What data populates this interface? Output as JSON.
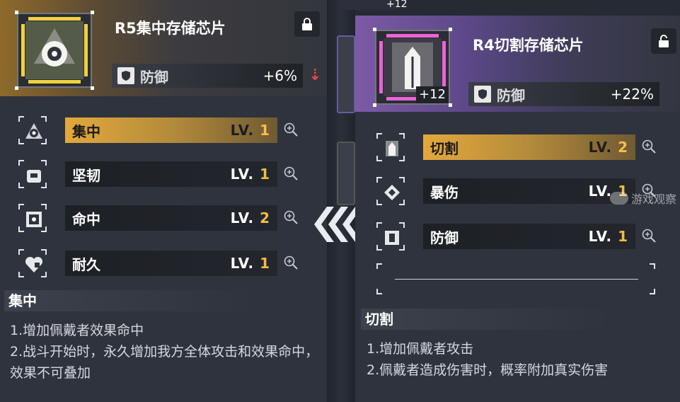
{
  "background": {
    "top_label": "+12"
  },
  "left_panel": {
    "title": "R5集中存储芯片",
    "stat": {
      "name": "防御",
      "value": "+6%"
    },
    "accent": "#e0a53a",
    "skills": [
      {
        "name": "集中",
        "lv_label": "LV.",
        "lv": "1",
        "active": true
      },
      {
        "name": "坚韧",
        "lv_label": "LV.",
        "lv": "1",
        "active": false
      },
      {
        "name": "命中",
        "lv_label": "LV.",
        "lv": "2",
        "active": false
      },
      {
        "name": "耐久",
        "lv_label": "LV.",
        "lv": "1",
        "active": false
      }
    ],
    "desc_title": "集中",
    "desc_lines": [
      "1.增加佩戴者效果命中",
      "2.战斗开始时，永久增加我方全体攻击和效果命中，效果不可叠加"
    ]
  },
  "right_panel": {
    "title": "R4切割存储芯片",
    "plus_level": "+12",
    "stat": {
      "name": "防御",
      "value": "+22%"
    },
    "accent": "#c26be0",
    "skills": [
      {
        "name": "切割",
        "lv_label": "LV.",
        "lv": "2",
        "active": true
      },
      {
        "name": "暴伤",
        "lv_label": "LV.",
        "lv": "1",
        "active": false
      },
      {
        "name": "防御",
        "lv_label": "LV.",
        "lv": "1",
        "active": false
      }
    ],
    "desc_title": "切割",
    "desc_lines": [
      "1.增加佩戴者攻击",
      "2.佩戴者造成伤害时，概率附加真实伤害"
    ]
  },
  "watermark": {
    "text": "游戏观察"
  }
}
